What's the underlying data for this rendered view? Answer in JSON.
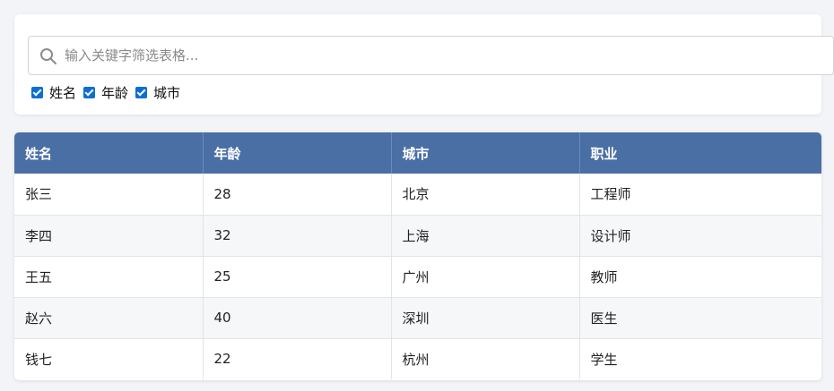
{
  "filter": {
    "search_placeholder": "输入关键字筛选表格...",
    "search_value": "",
    "search_icon": "search-icon",
    "columns": [
      {
        "label": "姓名",
        "checked": true
      },
      {
        "label": "年龄",
        "checked": true
      },
      {
        "label": "城市",
        "checked": true
      }
    ]
  },
  "table": {
    "headers": [
      "姓名",
      "年龄",
      "城市",
      "职业"
    ],
    "header_color": "#4a6fa5",
    "rows": [
      [
        "张三",
        "28",
        "北京",
        "工程师"
      ],
      [
        "李四",
        "32",
        "上海",
        "设计师"
      ],
      [
        "王五",
        "25",
        "广州",
        "教师"
      ],
      [
        "赵六",
        "40",
        "深圳",
        "医生"
      ],
      [
        "钱七",
        "22",
        "杭州",
        "学生"
      ]
    ]
  },
  "colors": {
    "checkbox": "#0b6fd1",
    "background": "#f3f4f8"
  }
}
